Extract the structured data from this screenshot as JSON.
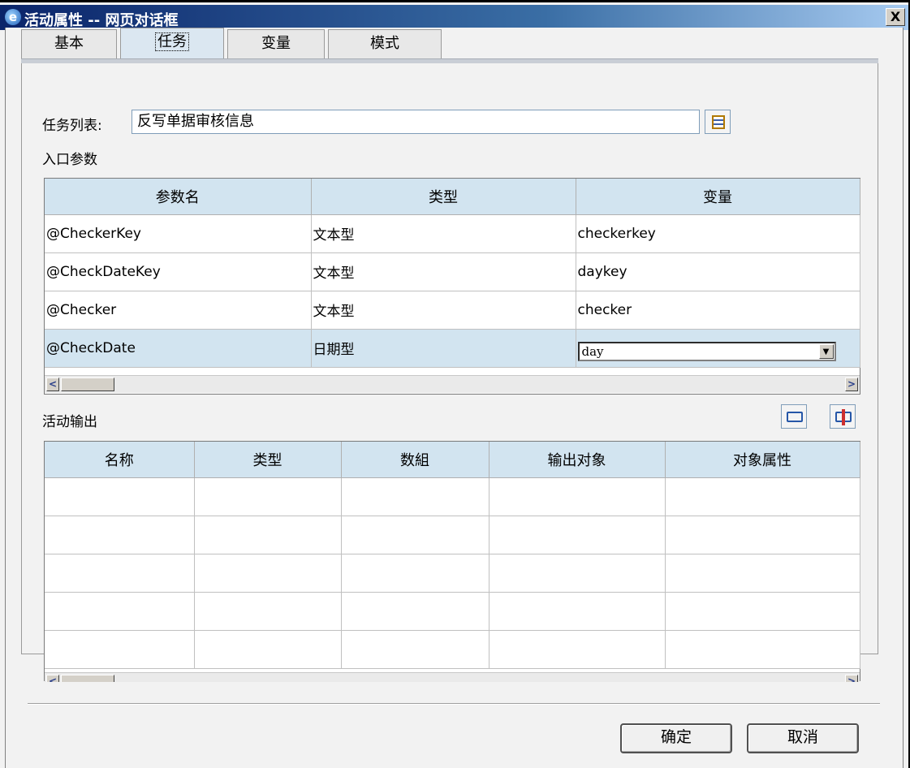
{
  "window": {
    "title": "活动属性 -- 网页对话框",
    "close_label": "X"
  },
  "tabs": [
    {
      "label": "基本",
      "active": false
    },
    {
      "label": "任务",
      "active": true
    },
    {
      "label": "变量",
      "active": false
    },
    {
      "label": "模式",
      "active": false
    }
  ],
  "task": {
    "label": "任务列表:",
    "value": "反写单据审核信息"
  },
  "entry_params": {
    "section_label": "入口参数",
    "columns": [
      "参数名",
      "类型",
      "变量"
    ],
    "rows": [
      {
        "name": "@CheckerKey",
        "type": "文本型",
        "variable": "checkerkey"
      },
      {
        "name": "@CheckDateKey",
        "type": "文本型",
        "variable": "daykey"
      },
      {
        "name": "@Checker",
        "type": "文本型",
        "variable": "checker"
      },
      {
        "name": "@CheckDate",
        "type": "日期型",
        "variable": "day",
        "selected": true
      }
    ]
  },
  "activity_output": {
    "section_label": "活动输出",
    "columns": [
      "名称",
      "类型",
      "数組",
      "输出对象",
      "对象属性"
    ],
    "rows": [
      [
        "",
        "",
        "",
        "",
        ""
      ],
      [
        "",
        "",
        "",
        "",
        ""
      ],
      [
        "",
        "",
        "",
        "",
        ""
      ],
      [
        "",
        "",
        "",
        "",
        ""
      ],
      [
        "",
        "",
        "",
        "",
        ""
      ]
    ]
  },
  "icons": {
    "list_picker": "list-icon",
    "add_output": "add-output-icon",
    "remove_output": "remove-output-icon"
  },
  "buttons": {
    "ok": "确定",
    "cancel": "取消"
  },
  "colors": {
    "header_bg": "#d2e4f0",
    "selected_row_bg": "#d2e4f0",
    "title_bar": "#0a246a"
  }
}
